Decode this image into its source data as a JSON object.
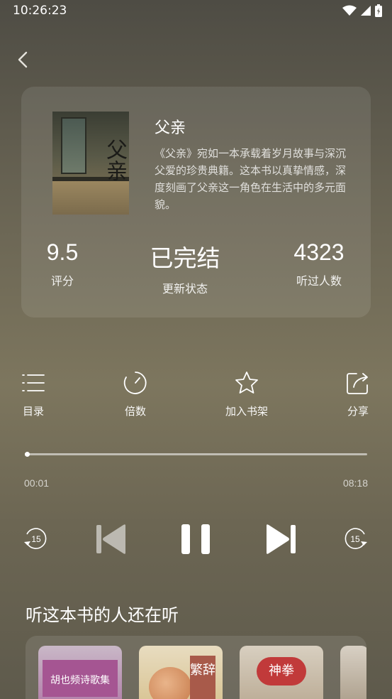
{
  "status_bar": {
    "time": "10:26:23",
    "icons": [
      "wifi-icon",
      "signal-icon",
      "battery-icon"
    ]
  },
  "book": {
    "title": "父亲",
    "cover_title": "父亲",
    "description": "《父亲》宛如一本承载着岁月故事与深沉父爱的珍贵典籍。这本书以真挚情感，深度刻画了父亲这一角色在生活中的多元面貌。",
    "stats": [
      {
        "value": "9.5",
        "label": "评分"
      },
      {
        "value": "已完结",
        "label": "更新状态"
      },
      {
        "value": "4323",
        "label": "听过人数"
      }
    ]
  },
  "actions": [
    {
      "icon": "list-icon",
      "label": "目录"
    },
    {
      "icon": "speed-icon",
      "label": "倍数"
    },
    {
      "icon": "star-icon",
      "label": "加入书架"
    },
    {
      "icon": "share-icon",
      "label": "分享"
    }
  ],
  "player": {
    "current_time": "00:01",
    "total_time": "08:18",
    "progress_fraction": 0.002,
    "rewind_seconds": "15",
    "forward_seconds": "15"
  },
  "recommendations": {
    "title": "听这本书的人还在听",
    "items": [
      {
        "title": "胡也频诗歌集"
      },
      {
        "title": "繁辞"
      },
      {
        "title": "神拳"
      },
      {
        "title": ""
      }
    ]
  }
}
